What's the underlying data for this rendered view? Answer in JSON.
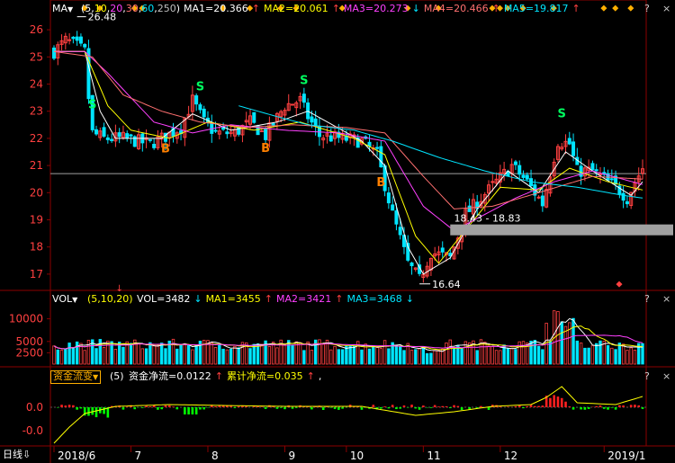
{
  "colors": {
    "up": "#ff4040",
    "down": "#00e5ff",
    "ma5": "#ffffff",
    "ma10": "#ffff00",
    "ma20": "#ff40ff",
    "ma30": "#ff7070",
    "ma60": "#00e5ff",
    "ma250": "#c0c0c0",
    "grid": "#8b0000",
    "flow_pos": "#ff2020",
    "flow_neg": "#00ff00",
    "flow_line": "#ffff00"
  },
  "price_panel": {
    "indicator": "MA",
    "params_open": "(",
    "params": [
      "5",
      "10",
      "20",
      "30",
      "60",
      "250"
    ],
    "params_close": ")",
    "readouts": [
      {
        "label": "MA1=20.366",
        "arrow": "↑",
        "color": "#ffffff"
      },
      {
        "label": "MA2=20.061",
        "arrow": "↑",
        "color": "#ffff00"
      },
      {
        "label": "MA3=20.273",
        "arrow": "↓",
        "color": "#ff40ff"
      },
      {
        "label": "MA4=20.466",
        "arrow": "↑",
        "color": "#ff7070"
      },
      {
        "label": "MA5=19.817",
        "arrow": "↑",
        "color": "#00e5ff"
      }
    ],
    "y_ticks": [
      "26",
      "25",
      "24",
      "23",
      "22",
      "21",
      "20",
      "19",
      "18",
      "17"
    ],
    "high_label": "26.48",
    "low_label": "16.64",
    "range_label": "18.43 - 18.83",
    "signals": [
      {
        "t": "S",
        "i": 10
      },
      {
        "t": "B",
        "i": 29
      },
      {
        "t": "S",
        "i": 38
      },
      {
        "t": "B",
        "i": 55
      },
      {
        "t": "S",
        "i": 65
      },
      {
        "t": "B",
        "i": 85
      },
      {
        "t": "S",
        "i": 132
      }
    ]
  },
  "volume_panel": {
    "indicator": "VOL",
    "params": "(5,10,20)",
    "readouts": [
      {
        "label": "VOL=3482",
        "arrow": "↓",
        "color": "#ffffff"
      },
      {
        "label": "MA1=3455",
        "arrow": "↑",
        "color": "#ffff00"
      },
      {
        "label": "MA2=3421",
        "arrow": "↑",
        "color": "#ff40ff"
      },
      {
        "label": "MA3=3468",
        "arrow": "↓",
        "color": "#00e5ff"
      }
    ],
    "y_ticks": [
      "10000",
      "5000",
      "2500"
    ]
  },
  "flow_panel": {
    "indicator": "资金流变",
    "params": "(5)",
    "readouts": [
      {
        "label": "资金净流=0.0122",
        "arrow": "↑",
        "color": "#ffffff"
      },
      {
        "label": "累计净流=0.035",
        "arrow": "↑",
        "color": "#ffff00"
      },
      {
        "label": ",",
        "arrow": "",
        "color": "#ffffff"
      }
    ],
    "y_ticks": [
      "0.0",
      "-0.0"
    ]
  },
  "x_axis": {
    "period": "日线",
    "period_arrow": "⇩",
    "labels": [
      "2018/6",
      "7",
      "8",
      "9",
      "10",
      "11",
      "12",
      "2019/1"
    ]
  },
  "icons": [
    "dropdown-icon",
    "question-icon",
    "close-icon"
  ],
  "chart_data": {
    "type": "candlestick",
    "x": [
      "2018/6",
      "7",
      "8",
      "9",
      "10",
      "11",
      "12",
      "2019/1"
    ],
    "ylim": [
      16.5,
      26.5
    ],
    "price_anchors": [
      [
        0,
        25.2
      ],
      [
        3,
        25.6
      ],
      [
        6,
        25.4
      ],
      [
        8,
        25.2
      ],
      [
        9,
        23.5
      ],
      [
        10,
        22.2
      ],
      [
        13,
        22.0
      ],
      [
        18,
        22.0
      ],
      [
        25,
        21.8
      ],
      [
        28,
        22.0
      ],
      [
        33,
        22.4
      ],
      [
        36,
        23.4
      ],
      [
        39,
        22.6
      ],
      [
        42,
        22.2
      ],
      [
        47,
        22.2
      ],
      [
        51,
        22.6
      ],
      [
        55,
        22.1
      ],
      [
        60,
        23.2
      ],
      [
        64,
        23.4
      ],
      [
        66,
        22.8
      ],
      [
        69,
        22.1
      ],
      [
        75,
        22.0
      ],
      [
        80,
        21.9
      ],
      [
        84,
        21.4
      ],
      [
        88,
        19.2
      ],
      [
        92,
        17.4
      ],
      [
        95,
        16.8
      ],
      [
        98,
        17.8
      ],
      [
        103,
        17.6
      ],
      [
        107,
        19.2
      ],
      [
        111,
        19.8
      ],
      [
        115,
        20.4
      ],
      [
        119,
        21.0
      ],
      [
        123,
        20.4
      ],
      [
        127,
        19.6
      ],
      [
        131,
        21.9
      ],
      [
        134,
        21.8
      ],
      [
        136,
        20.8
      ],
      [
        140,
        20.8
      ],
      [
        144,
        20.4
      ],
      [
        147,
        20.1
      ],
      [
        149,
        19.8
      ],
      [
        151,
        20.4
      ],
      [
        153,
        20.9
      ]
    ],
    "series": [
      {
        "name": "MA1",
        "anchors": [
          [
            0,
            25.2
          ],
          [
            8,
            25.2
          ],
          [
            12,
            23.0
          ],
          [
            16,
            22.0
          ],
          [
            28,
            22.0
          ],
          [
            36,
            22.9
          ],
          [
            46,
            22.3
          ],
          [
            58,
            22.6
          ],
          [
            66,
            23.0
          ],
          [
            80,
            21.9
          ],
          [
            86,
            21.0
          ],
          [
            92,
            18.0
          ],
          [
            96,
            17.0
          ],
          [
            103,
            17.6
          ],
          [
            110,
            19.4
          ],
          [
            118,
            20.8
          ],
          [
            126,
            20.0
          ],
          [
            133,
            21.5
          ],
          [
            140,
            20.8
          ],
          [
            150,
            19.9
          ],
          [
            153,
            20.4
          ]
        ]
      },
      {
        "name": "MA2",
        "anchors": [
          [
            0,
            25.2
          ],
          [
            8,
            25.2
          ],
          [
            14,
            23.2
          ],
          [
            20,
            22.3
          ],
          [
            30,
            22.0
          ],
          [
            40,
            22.6
          ],
          [
            52,
            22.3
          ],
          [
            64,
            22.6
          ],
          [
            78,
            22.0
          ],
          [
            86,
            21.4
          ],
          [
            94,
            18.4
          ],
          [
            100,
            17.4
          ],
          [
            108,
            18.8
          ],
          [
            116,
            20.2
          ],
          [
            126,
            20.1
          ],
          [
            134,
            20.9
          ],
          [
            144,
            20.4
          ],
          [
            153,
            20.1
          ]
        ]
      },
      {
        "name": "MA3",
        "anchors": [
          [
            0,
            25.2
          ],
          [
            8,
            25.2
          ],
          [
            14,
            24.4
          ],
          [
            26,
            22.6
          ],
          [
            36,
            22.2
          ],
          [
            46,
            22.5
          ],
          [
            60,
            22.3
          ],
          [
            74,
            22.2
          ],
          [
            86,
            21.9
          ],
          [
            96,
            19.5
          ],
          [
            104,
            18.6
          ],
          [
            112,
            19.2
          ],
          [
            120,
            19.8
          ],
          [
            130,
            20.4
          ],
          [
            140,
            20.8
          ],
          [
            153,
            20.3
          ]
        ]
      },
      {
        "name": "MA4",
        "anchors": [
          [
            0,
            25.2
          ],
          [
            10,
            25.0
          ],
          [
            18,
            23.6
          ],
          [
            28,
            23.0
          ],
          [
            38,
            22.6
          ],
          [
            50,
            22.4
          ],
          [
            62,
            22.5
          ],
          [
            76,
            22.4
          ],
          [
            86,
            22.2
          ],
          [
            96,
            20.6
          ],
          [
            104,
            19.4
          ],
          [
            114,
            19.5
          ],
          [
            126,
            20.0
          ],
          [
            140,
            20.6
          ],
          [
            153,
            20.5
          ]
        ]
      },
      {
        "name": "MA5",
        "anchors": [
          [
            48,
            23.2
          ],
          [
            58,
            22.8
          ],
          [
            66,
            22.5
          ],
          [
            78,
            22.3
          ],
          [
            88,
            21.9
          ],
          [
            100,
            21.3
          ],
          [
            112,
            20.8
          ],
          [
            124,
            20.4
          ],
          [
            136,
            20.2
          ],
          [
            148,
            19.9
          ],
          [
            153,
            19.8
          ]
        ]
      },
      {
        "name": "MA250",
        "anchors": [
          [
            80,
            20.7
          ],
          [
            153,
            20.7
          ]
        ]
      }
    ],
    "volume_series": [
      {
        "name": "VOL",
        "ylim": [
          0,
          12500
        ]
      }
    ],
    "flow_series": [
      {
        "name": "资金净流"
      },
      {
        "name": "累计净流"
      }
    ]
  }
}
